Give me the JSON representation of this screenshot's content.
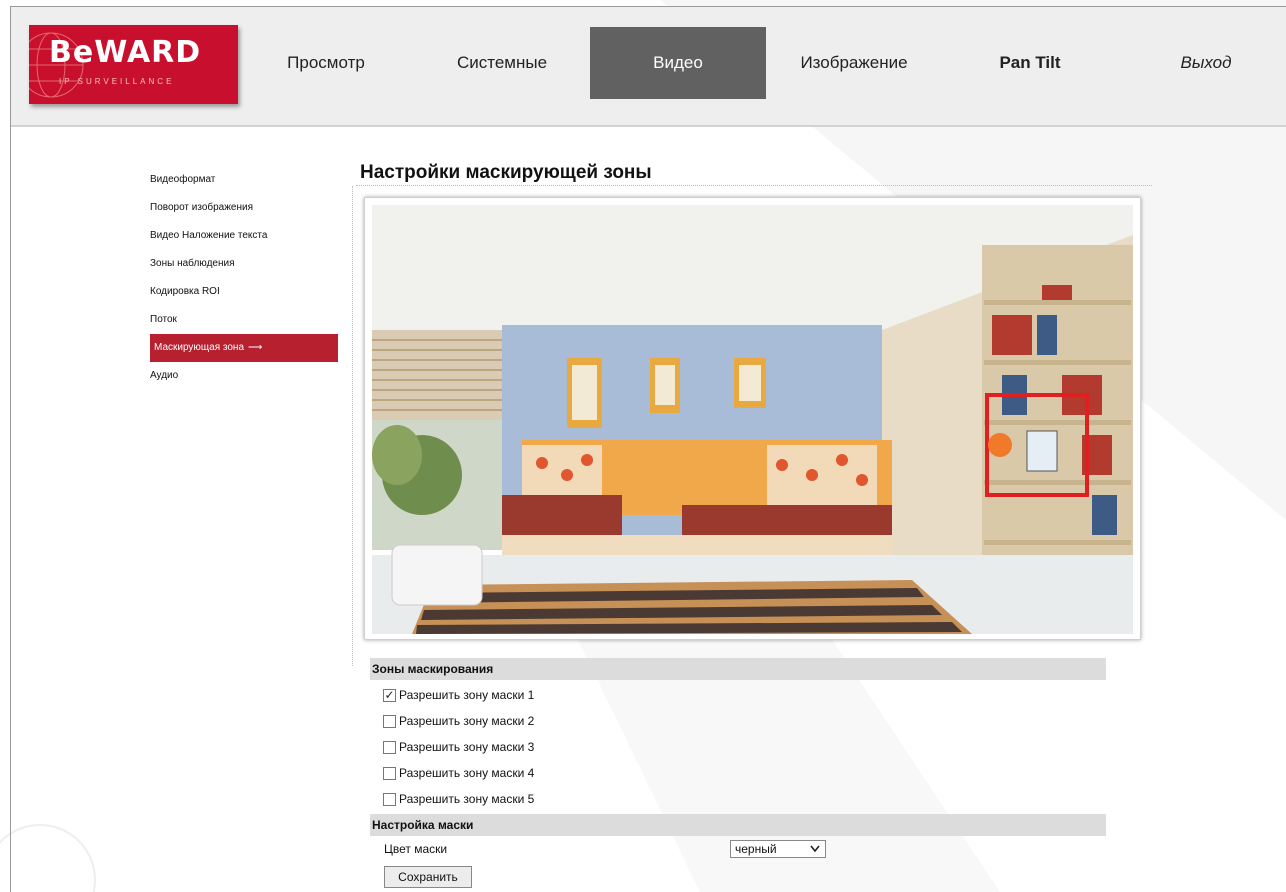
{
  "header": {
    "logo_text": "BeWARD",
    "logo_sub": "IP SURVEILLANCE",
    "nav": [
      {
        "label": "Просмотр"
      },
      {
        "label": "Системные"
      },
      {
        "label": "Видео"
      },
      {
        "label": "Изображение"
      },
      {
        "label": "Pan Tilt"
      },
      {
        "label": "Выход"
      }
    ],
    "active_tab": "Видео"
  },
  "sidebar": {
    "items": [
      {
        "label": "Видеоформат"
      },
      {
        "label": "Поворот изображения"
      },
      {
        "label": "Видео Наложение текста"
      },
      {
        "label": "Зоны наблюдения"
      },
      {
        "label": "Кодировка ROI"
      },
      {
        "label": "Поток"
      },
      {
        "label": "Маскирующая зона"
      },
      {
        "label": "Аудио"
      }
    ],
    "active_item": "Маскирующая зона",
    "active_arrow": "⟶"
  },
  "main": {
    "title": "Настройки маскирующей зоны",
    "zones_header": "Зоны маскирования",
    "zones": [
      {
        "label": "Разрешить зону маски 1",
        "checked": true
      },
      {
        "label": "Разрешить зону маски 2",
        "checked": false
      },
      {
        "label": "Разрешить зону маски 3",
        "checked": false
      },
      {
        "label": "Разрешить зону маски 4",
        "checked": false
      },
      {
        "label": "Разрешить зону маски 5",
        "checked": false
      }
    ],
    "mask_header": "Настройка маски",
    "mask_color_label": "Цвет маски",
    "mask_color_value": "черный",
    "save_label": "Сохранить"
  },
  "colors": {
    "brand_red": "#c8102e",
    "active_nav": "#616161",
    "active_side": "#b6202f",
    "mask_rect": "#e02020"
  }
}
